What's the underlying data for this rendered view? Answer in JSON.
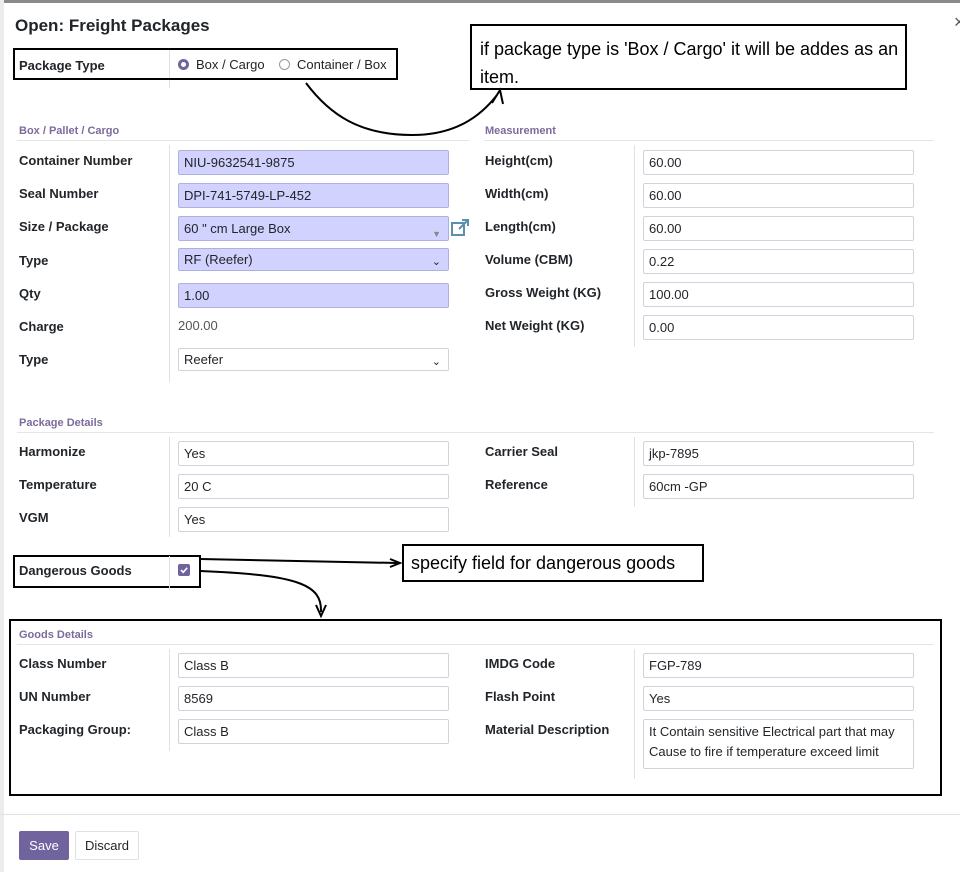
{
  "dialog": {
    "title": "Open: Freight Packages"
  },
  "package_type": {
    "label": "Package Type",
    "options": [
      "Box / Cargo",
      "Container / Box"
    ],
    "selected": "Box / Cargo"
  },
  "annotations": {
    "package_note": "if package type is 'Box / Cargo' it will be addes as an item.",
    "dangerous_note": "specify field for dangerous goods"
  },
  "box_section": {
    "title": "Box / Pallet / Cargo",
    "container_number": {
      "label": "Container Number",
      "value": "NIU-9632541-9875"
    },
    "seal_number": {
      "label": "Seal Number",
      "value": "DPI-741-5749-LP-452"
    },
    "size_package": {
      "label": "Size / Package",
      "value": "60 \" cm Large Box"
    },
    "type": {
      "label": "Type",
      "value": "RF (Reefer)"
    },
    "qty": {
      "label": "Qty",
      "value": "1.00"
    },
    "charge": {
      "label": "Charge",
      "value": "200.00"
    },
    "type2": {
      "label": "Type",
      "value": "Reefer"
    }
  },
  "measurement": {
    "title": "Measurement",
    "height": {
      "label": "Height(cm)",
      "value": "60.00"
    },
    "width": {
      "label": "Width(cm)",
      "value": "60.00"
    },
    "length": {
      "label": "Length(cm)",
      "value": "60.00"
    },
    "volume": {
      "label": "Volume (CBM)",
      "value": "0.22"
    },
    "gross_weight": {
      "label": "Gross Weight (KG)",
      "value": "100.00"
    },
    "net_weight": {
      "label": "Net Weight (KG)",
      "value": "0.00"
    }
  },
  "package_details": {
    "title": "Package Details",
    "harmonize": {
      "label": "Harmonize",
      "value": "Yes"
    },
    "temperature": {
      "label": "Temperature",
      "value": "20 C"
    },
    "vgm": {
      "label": "VGM",
      "value": "Yes"
    },
    "carrier_seal": {
      "label": "Carrier Seal",
      "value": "jkp-7895"
    },
    "reference": {
      "label": "Reference",
      "value": "60cm -GP"
    },
    "dangerous_goods": {
      "label": "Dangerous Goods",
      "checked": true
    }
  },
  "goods_details": {
    "title": "Goods Details",
    "class_number": {
      "label": "Class Number",
      "value": "Class B"
    },
    "un_number": {
      "label": "UN Number",
      "value": "8569"
    },
    "packaging_group": {
      "label": "Packaging Group:",
      "value": "Class B"
    },
    "imdg_code": {
      "label": "IMDG Code",
      "value": "FGP-789"
    },
    "flash_point": {
      "label": "Flash Point",
      "value": "Yes"
    },
    "material_description": {
      "label": "Material Description",
      "line1": "It Contain sensitive Electrical part that may",
      "line2": "Cause to fire if temperature exceed limit"
    }
  },
  "footer": {
    "save_label": "Save",
    "discard_label": "Discard"
  },
  "colors": {
    "primary": "#71639e",
    "required_bg": "#d2d2ff",
    "section_title": "#7c6b9a",
    "link_icon": "#5b8fb0"
  },
  "icons": [
    "external-link-icon",
    "dropdown-caret-icon",
    "checkbox-check-icon",
    "close-icon"
  ]
}
